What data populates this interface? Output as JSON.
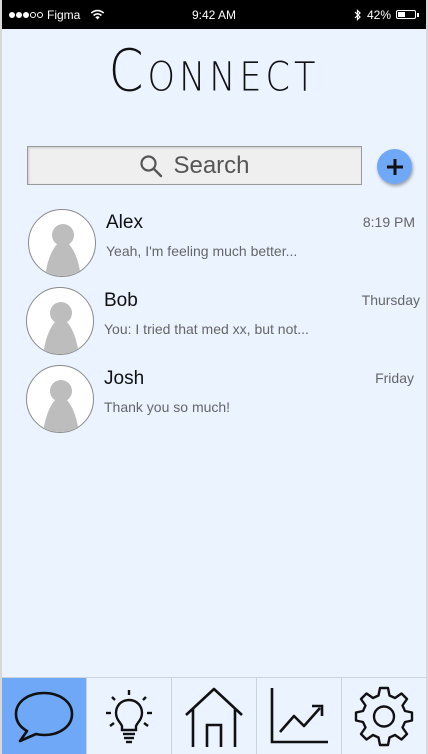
{
  "status_bar": {
    "carrier": "Figma",
    "time": "9:42 AM",
    "battery": "42%",
    "battery_level": 0.42
  },
  "app": {
    "title": "Connect"
  },
  "search": {
    "placeholder": "Search"
  },
  "conversations": [
    {
      "name": "Alex",
      "preview": "Yeah, I'm feeling much better...",
      "time": "8:19 PM"
    },
    {
      "name": "Bob",
      "preview": "You: I tried that med xx, but not...",
      "time": "Thursday"
    },
    {
      "name": "Josh",
      "preview": "Thank you so much!",
      "time": "Friday"
    }
  ],
  "tab_bar": {
    "tabs": [
      {
        "icon": "chat-bubble-icon",
        "active": true
      },
      {
        "icon": "lightbulb-icon",
        "active": false
      },
      {
        "icon": "home-icon",
        "active": false
      },
      {
        "icon": "chart-trend-icon",
        "active": false
      },
      {
        "icon": "gear-icon",
        "active": false
      }
    ]
  },
  "colors": {
    "accent": "#6ea8f7",
    "background": "#eaf3ff"
  }
}
